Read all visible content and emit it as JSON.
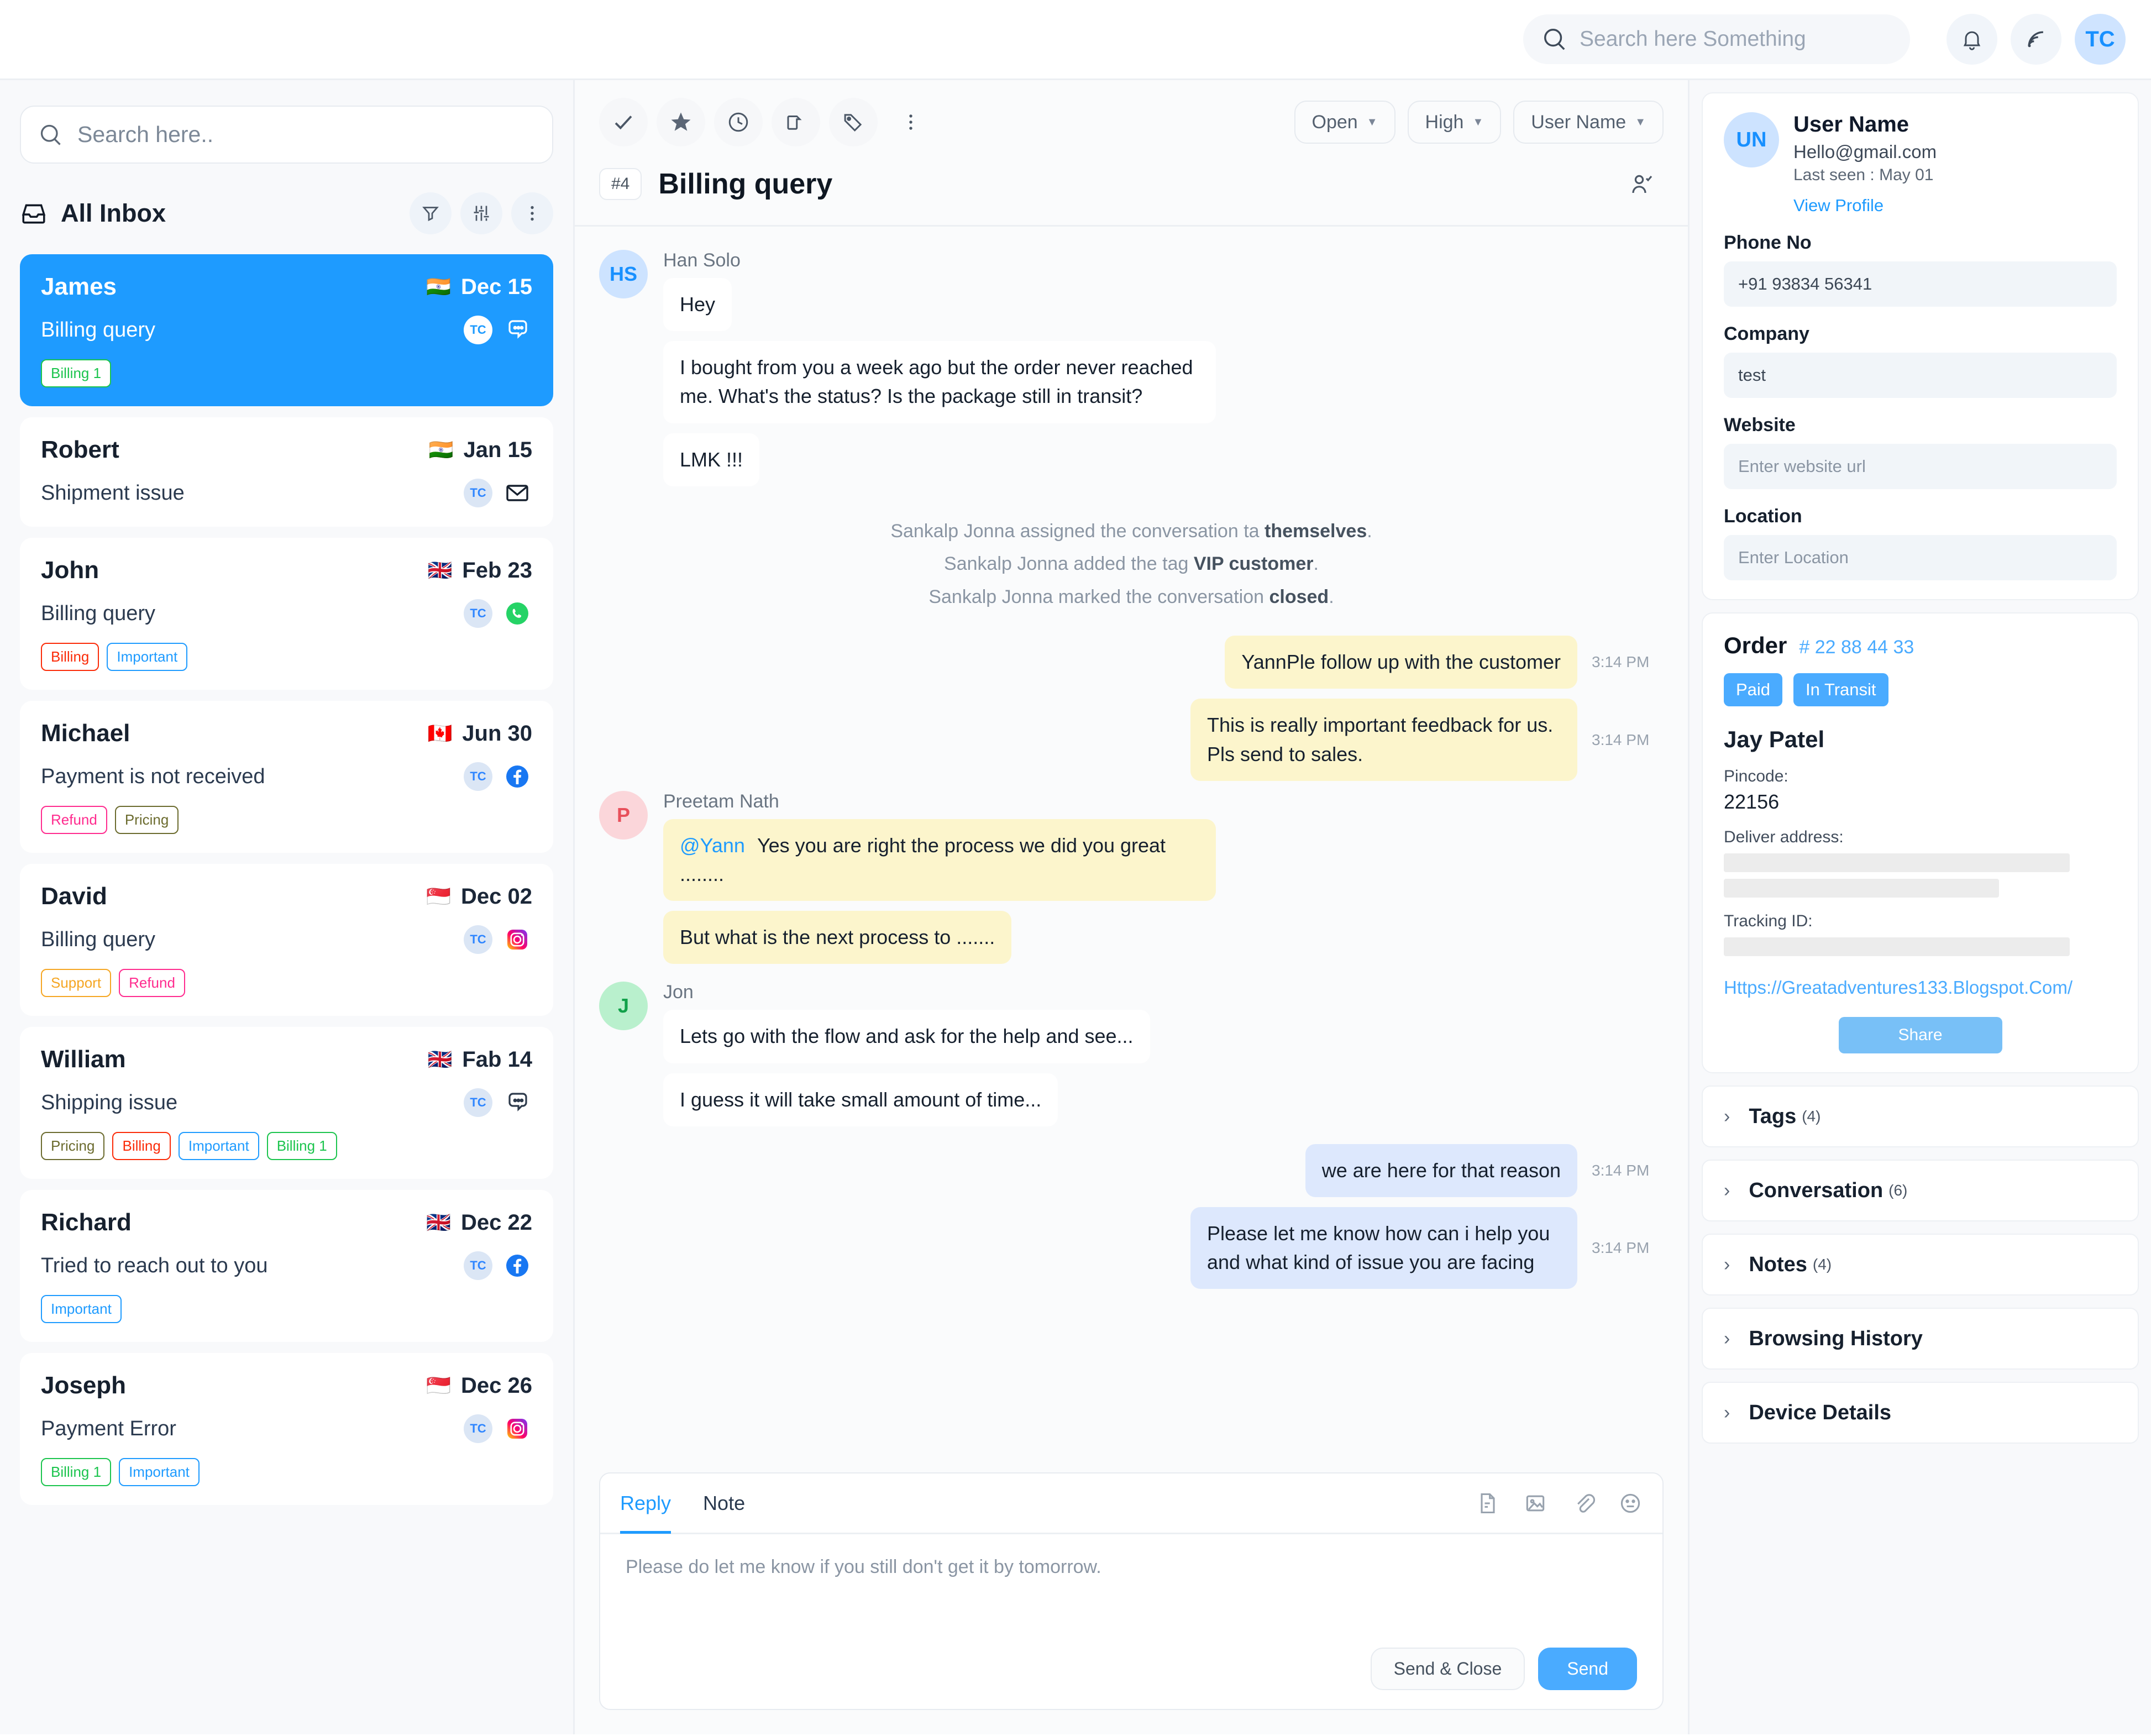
{
  "topbar": {
    "search_placeholder": "Search here Something",
    "notification_icon": "bell-icon",
    "activity_icon": "broadcast-icon",
    "avatar_initials": "TC"
  },
  "sidebar": {
    "search_placeholder": "Search here..",
    "inbox_label": "All Inbox",
    "actions": [
      "filter-icon",
      "sliders-icon",
      "more-vertical-icon"
    ],
    "conversations": [
      {
        "name": "James",
        "flag": "🇮🇳",
        "date": "Dec 15",
        "subject": "Billing query",
        "agent": "TC",
        "channel": "chat-icon",
        "active": true,
        "tags": [
          {
            "label": "Billing 1",
            "color": "#1bc44d"
          }
        ]
      },
      {
        "name": "Robert",
        "flag": "🇮🇳",
        "date": "Jan 15",
        "subject": "Shipment issue",
        "agent": "TC",
        "channel": "email-icon",
        "active": false,
        "tags": []
      },
      {
        "name": "John",
        "flag": "🇬🇧",
        "date": "Feb 23",
        "subject": "Billing query",
        "agent": "TC",
        "channel": "whatsapp-icon",
        "active": false,
        "tags": [
          {
            "label": "Billing",
            "color": "#fb2b08"
          },
          {
            "label": "Important",
            "color": "#1e9bff"
          }
        ]
      },
      {
        "name": "Michael",
        "flag": "🇨🇦",
        "date": "Jun 30",
        "subject": "Payment is not received",
        "agent": "TC",
        "channel": "facebook-icon",
        "active": false,
        "tags": [
          {
            "label": "Refund",
            "color": "#ff2b8e"
          },
          {
            "label": "Pricing",
            "color": "#6b6b2e"
          }
        ]
      },
      {
        "name": "David",
        "flag": "🇸🇬",
        "date": "Dec 02",
        "subject": "Billing query",
        "agent": "TC",
        "channel": "instagram-icon",
        "active": false,
        "tags": [
          {
            "label": "Support",
            "color": "#f5a623"
          },
          {
            "label": "Refund",
            "color": "#ff2b8e"
          }
        ]
      },
      {
        "name": "William",
        "flag": "🇬🇧",
        "date": "Fab 14",
        "subject": "Shipping issue",
        "agent": "TC",
        "channel": "chat-icon",
        "active": false,
        "tags": [
          {
            "label": "Pricing",
            "color": "#6b6b2e"
          },
          {
            "label": "Billing",
            "color": "#fb2b08"
          },
          {
            "label": "Important",
            "color": "#1e9bff"
          },
          {
            "label": "Billing 1",
            "color": "#1bc44d"
          }
        ]
      },
      {
        "name": "Richard",
        "flag": "🇬🇧",
        "date": "Dec 22",
        "subject": "Tried to reach out to you",
        "agent": "TC",
        "channel": "facebook-icon",
        "active": false,
        "tags": [
          {
            "label": "Important",
            "color": "#1e9bff"
          }
        ]
      },
      {
        "name": "Joseph",
        "flag": "🇸🇬",
        "date": "Dec 26",
        "subject": "Payment Error",
        "agent": "TC",
        "channel": "instagram-icon",
        "active": false,
        "tags": [
          {
            "label": "Billing 1",
            "color": "#1bc44d"
          },
          {
            "label": "Important",
            "color": "#1e9bff"
          }
        ]
      }
    ]
  },
  "conversation": {
    "toolbar_icons": [
      "check-icon",
      "star-icon",
      "clock-icon",
      "folder-icon",
      "tag-icon",
      "more-vertical-icon"
    ],
    "status_label": "Open",
    "priority_label": "High",
    "assignee_label": "User Name",
    "ticket_number": "#4",
    "title": "Billing query",
    "assign_icon": "assign-user-icon",
    "messages": [
      {
        "kind": "incoming_group",
        "avatar": "HS",
        "avatar_class": "hs",
        "sender": "Han Solo",
        "bubbles": [
          "Hey",
          "I bought from you a week ago but the order never reached me. What's the status? Is the package still in transit?",
          "LMK !!!"
        ]
      },
      {
        "kind": "system",
        "lines": [
          {
            "pre": "Sankalp Jonna assigned the conversation ta ",
            "strong": "themselves",
            "post": "."
          },
          {
            "pre": "Sankalp Jonna added the tag ",
            "strong": "VIP customer",
            "post": "."
          },
          {
            "pre": "Sankalp Jonna marked the conversation ",
            "strong": "closed",
            "post": "."
          }
        ]
      },
      {
        "kind": "outgoing_note",
        "mention": "Yann",
        "text": "Ple follow up with the customer",
        "time": "3:14 PM"
      },
      {
        "kind": "outgoing_note",
        "mention": "",
        "text": "This is really important feedback for us. Pls send to sales.",
        "time": "3:14 PM"
      },
      {
        "kind": "incoming_note_group",
        "avatar": "P",
        "avatar_class": "p",
        "sender": "Preetam Nath",
        "bubbles": [
          {
            "mention": "@Yann",
            "text": "Yes you are right the process we did you great ........"
          },
          {
            "mention": "",
            "text": "But what is the next process to ......."
          }
        ]
      },
      {
        "kind": "incoming_group",
        "avatar": "J",
        "avatar_class": "j",
        "sender": "Jon",
        "bubbles": [
          "Lets go with the flow and ask for the help and see...",
          "I guess it will take small amount of time..."
        ]
      },
      {
        "kind": "outgoing",
        "text": "we are here for that reason",
        "time": "3:14 PM"
      },
      {
        "kind": "outgoing",
        "text": "Please let me know how can i help you and what kind of issue you are facing",
        "time": "3:14 PM"
      }
    ]
  },
  "composer": {
    "tabs": [
      {
        "label": "Reply",
        "active": true
      },
      {
        "label": "Note",
        "active": false
      }
    ],
    "icons": [
      "document-icon",
      "image-icon",
      "attachment-icon",
      "emoji-icon"
    ],
    "draft_text": "Please do let me know if you still don't get it by tomorrow.",
    "secondary_button": "Send & Close",
    "primary_button": "Send"
  },
  "profile": {
    "avatar_initials": "UN",
    "name": "User Name",
    "email": "Hello@gmail.com",
    "last_seen": "Last seen : May 01",
    "view_profile": "View Profile",
    "fields": [
      {
        "label": "Phone No",
        "value": "+91 93834 56341",
        "placeholder": ""
      },
      {
        "label": "Company",
        "value": "test",
        "placeholder": ""
      },
      {
        "label": "Website",
        "value": "",
        "placeholder": "Enter website url"
      },
      {
        "label": "Location",
        "value": "",
        "placeholder": "Enter Location"
      }
    ]
  },
  "order": {
    "title": "Order",
    "number": "# 22 88 44 33",
    "chips": [
      "Paid",
      "In Transit"
    ],
    "customer": "Jay Patel",
    "pincode_label": "Pincode:",
    "pincode_value": "22156",
    "address_label": "Deliver address:",
    "tracking_label": "Tracking ID:",
    "url": "Https://Greatadventures133.Blogspot.Com/",
    "share_button": "Share"
  },
  "accordions": [
    {
      "label": "Tags",
      "count": "(4)"
    },
    {
      "label": "Conversation",
      "count": "(6)"
    },
    {
      "label": "Notes",
      "count": "(4)"
    },
    {
      "label": "Browsing History",
      "count": ""
    },
    {
      "label": "Device Details",
      "count": ""
    }
  ],
  "colors": {
    "accent": "#1e9bff",
    "note_bg": "#fcf5cc",
    "outgoing_bg": "#dde8fd",
    "panel_bg": "#f8f9fb"
  }
}
